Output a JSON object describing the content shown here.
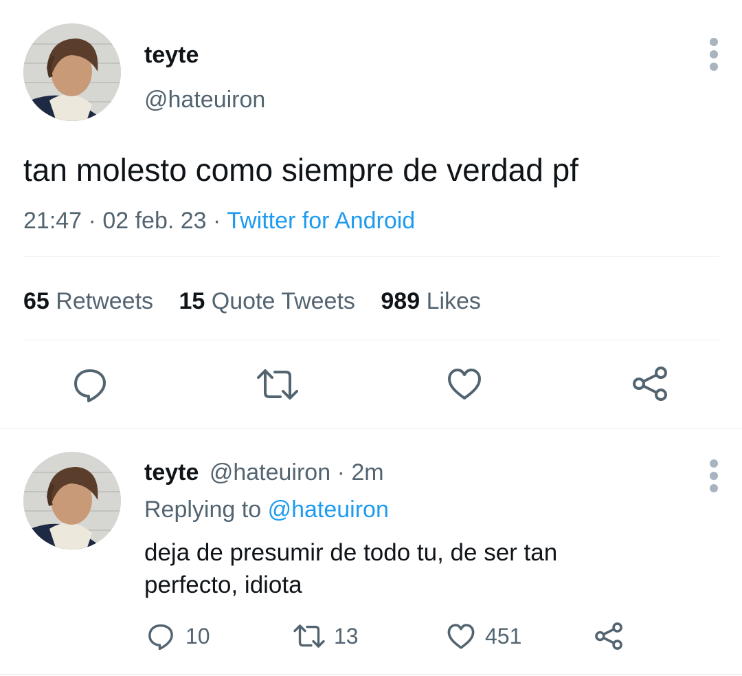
{
  "main_tweet": {
    "display_name": "teyte",
    "handle": "@hateuiron",
    "text": "tan molesto como siempre de verdad pf",
    "time": "21:47",
    "date": "02 feb. 23",
    "sep": "·",
    "source": "Twitter for Android",
    "stats": {
      "retweets_count": "65",
      "retweets_label": "Retweets",
      "quotes_count": "15",
      "quotes_label": "Quote Tweets",
      "likes_count": "989",
      "likes_label": "Likes"
    },
    "icons": [
      "reply-icon",
      "retweet-icon",
      "like-icon",
      "share-icon",
      "more-icon"
    ]
  },
  "reply_tweet": {
    "display_name": "teyte",
    "handle": "@hateuiron",
    "sep": "·",
    "age": "2m",
    "replying_label": "Replying to",
    "replying_handle": "@hateuiron",
    "text_line1": "deja de presumir de todo tu, de ser tan",
    "text_line2": "perfecto, idiota",
    "reply_count": "10",
    "retweet_count": "13",
    "like_count": "451"
  },
  "colors": {
    "text": "#0f1419",
    "muted": "#536471",
    "link": "#1d9bf0",
    "divider": "#e6e9ec"
  }
}
